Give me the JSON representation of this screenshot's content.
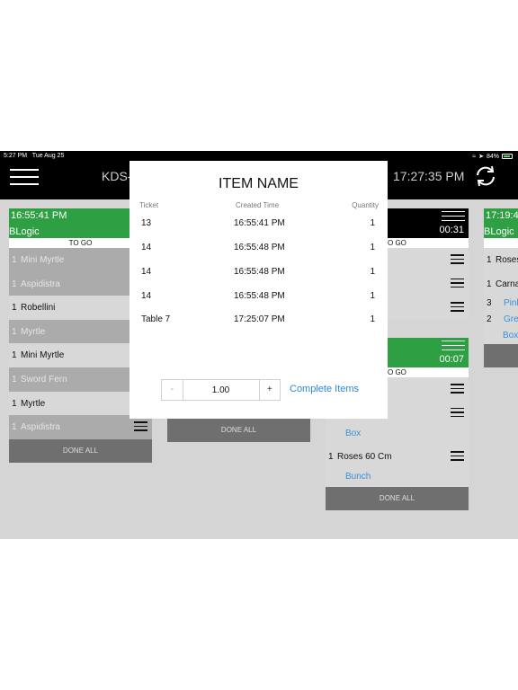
{
  "status_bar": {
    "time": "5:27 PM",
    "date": "Tue Aug 25",
    "battery": "84%"
  },
  "app": {
    "title": "KDS-",
    "clock": "17:27:35 PM"
  },
  "cards": [
    {
      "header_time": "16:55:41 PM",
      "header_sub": "BLogic",
      "header_right_top": "",
      "header_right": "0",
      "order_type": "TO GO",
      "rows": [
        {
          "qty": "1",
          "name": "Mini Myrtle",
          "done": true
        },
        {
          "qty": "1",
          "name": "Aspidistra",
          "done": true
        },
        {
          "qty": "1",
          "name": "Robellini",
          "done": false
        },
        {
          "qty": "1",
          "name": "Myrtle",
          "done": true
        },
        {
          "qty": "1",
          "name": "Mini Myrtle",
          "done": false
        },
        {
          "qty": "1",
          "name": "Sword Fern",
          "done": true
        },
        {
          "qty": "1",
          "name": "Myrtle",
          "done": false
        },
        {
          "qty": "1",
          "name": "Aspidistra",
          "done": true
        }
      ],
      "done_all": "DONE ALL"
    },
    {
      "done_all": "DONE ALL"
    },
    {
      "top_header_right": "00:31",
      "top_order_type": "O GO",
      "header_right": "00:07",
      "order_type": "O GO",
      "modifier_box": "Box",
      "item_qty": "1",
      "item_name": "Roses 60 Cm",
      "modifier_bunch": "Bunch",
      "done_all": "DONE ALL"
    },
    {
      "header_time": "17:19:4",
      "header_sub": "BLogic",
      "rows": [
        {
          "qty": "1",
          "name": "Roses"
        },
        {
          "qty": "1",
          "name": "Carna"
        },
        {
          "qty": "3",
          "name": "Pink"
        },
        {
          "qty": "2",
          "name": "Gre"
        },
        {
          "qty": "",
          "name": "Box"
        }
      ]
    }
  ],
  "modal": {
    "title": "ITEM NAME",
    "headers": {
      "ticket": "Ticket",
      "created": "Created Time",
      "quantity": "Quantity"
    },
    "rows": [
      {
        "ticket": "13",
        "time": "16:55:41 PM",
        "qty": "1"
      },
      {
        "ticket": "14",
        "time": "16:55:48 PM",
        "qty": "1"
      },
      {
        "ticket": "14",
        "time": "16:55:48 PM",
        "qty": "1"
      },
      {
        "ticket": "14",
        "time": "16:55:48 PM",
        "qty": "1"
      },
      {
        "ticket": "Table 7",
        "time": "17:25:07 PM",
        "qty": "1"
      }
    ],
    "stepper": {
      "minus": "-",
      "value": "1.00",
      "plus": "+"
    },
    "complete_label": "Complete Items"
  },
  "colors": {
    "accent_green": "#2ea043",
    "link_blue": "#2f86d6"
  }
}
